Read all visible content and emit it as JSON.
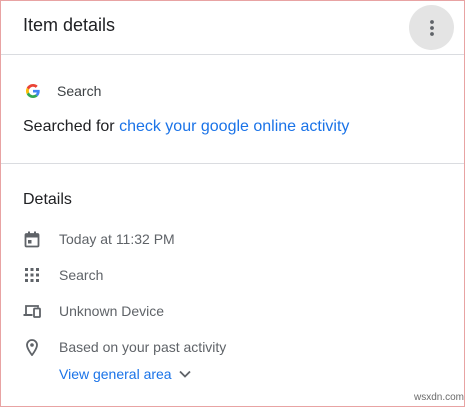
{
  "header": {
    "title": "Item details",
    "more_icon": "more-vert-icon"
  },
  "source": {
    "icon": "google-g-icon",
    "label": "Search"
  },
  "activity": {
    "prefix": "Searched for",
    "query": "check your google online activity"
  },
  "details": {
    "heading": "Details",
    "rows": [
      {
        "icon": "calendar-icon",
        "text": "Today at 11:32 PM"
      },
      {
        "icon": "apps-grid-icon",
        "text": "Search"
      },
      {
        "icon": "devices-icon",
        "text": "Unknown Device"
      },
      {
        "icon": "location-pin-icon",
        "text": "Based on your past activity"
      }
    ],
    "area_link": "View general area"
  },
  "watermark": "wsxdn.com",
  "colors": {
    "link": "#1a73e8",
    "icon": "#5f6368",
    "text": "#202124",
    "border": "#e8a3a3"
  }
}
